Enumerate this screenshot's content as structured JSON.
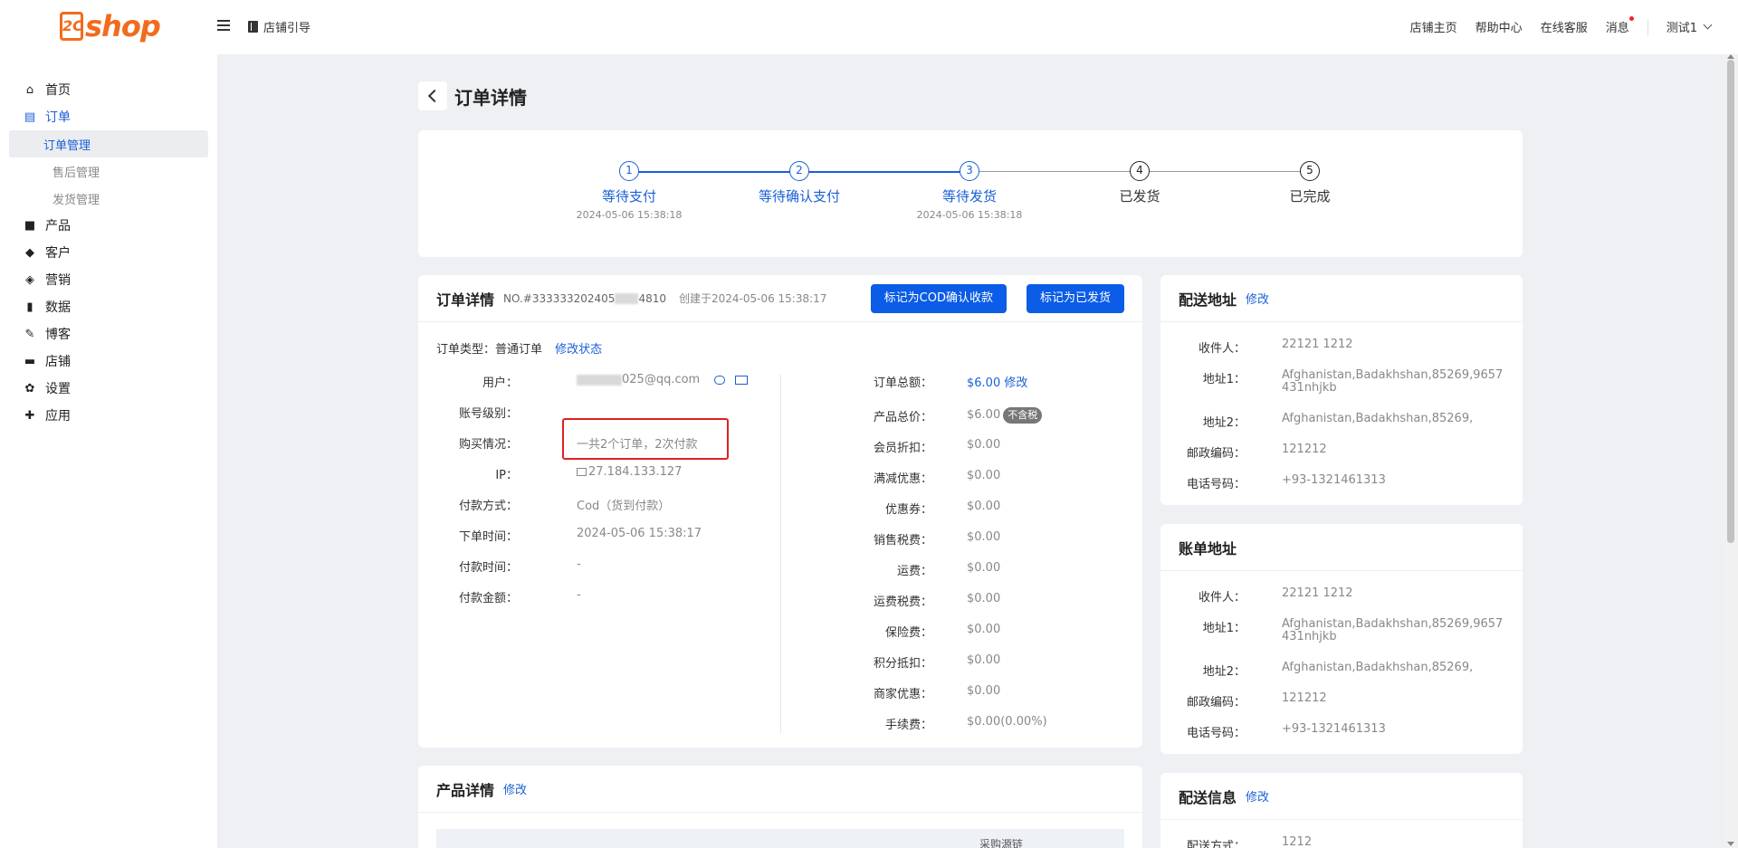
{
  "header": {
    "logo_text": "shop",
    "logo_prefix": "2C",
    "guide_label": "店铺引导",
    "links": [
      "店铺主页",
      "帮助中心",
      "在线客服",
      "消息"
    ],
    "user_name": "测试1"
  },
  "sidebar": {
    "items": [
      {
        "label": "首页",
        "icon": "home-icon"
      },
      {
        "label": "订单",
        "icon": "order-icon"
      },
      {
        "label": "产品",
        "icon": "bag-icon"
      },
      {
        "label": "客户",
        "icon": "diamond-icon"
      },
      {
        "label": "营销",
        "icon": "tag-icon"
      },
      {
        "label": "数据",
        "icon": "bar-chart-icon"
      },
      {
        "label": "博客",
        "icon": "edit-icon"
      },
      {
        "label": "店铺",
        "icon": "store-icon"
      },
      {
        "label": "设置",
        "icon": "gear-icon"
      },
      {
        "label": "应用",
        "icon": "puzzle-icon"
      }
    ],
    "order_sub": [
      "订单管理",
      "售后管理",
      "发货管理"
    ]
  },
  "page": {
    "title": "订单详情"
  },
  "steps": [
    {
      "num": "1",
      "name": "等待支付",
      "time": "2024-05-06 15:38:18",
      "state": "active"
    },
    {
      "num": "2",
      "name": "等待确认支付",
      "time": "",
      "state": "active"
    },
    {
      "num": "3",
      "name": "等待发货",
      "time": "2024-05-06 15:38:18",
      "state": "active"
    },
    {
      "num": "4",
      "name": "已发货",
      "time": "",
      "state": "pending"
    },
    {
      "num": "5",
      "name": "已完成",
      "time": "",
      "state": "pending"
    }
  ],
  "order": {
    "title": "订单详情",
    "number_prefix": "NO.#333333202405",
    "number_suffix": "4810",
    "created": "创建于2024-05-06 15:38:17",
    "btn_cod": "标记为COD确认收款",
    "btn_shipped": "标记为已发货",
    "type_label": "订单类型：普通订单",
    "modify_status": "修改状态",
    "left_labels": [
      "用户：",
      "账号级别：",
      "购买情况：",
      "IP：",
      "付款方式：",
      "下单时间：",
      "付款时间：",
      "付款金额："
    ],
    "user_email_suffix": "025@qq.com",
    "account_level": "",
    "purchase": "一共2个订单，2次付款",
    "ip": "27.184.133.127",
    "pay_method": "Cod（货到付款）",
    "order_time": "2024-05-06 15:38:17",
    "pay_time": "-",
    "pay_amount": "-",
    "right_labels": [
      "订单总额：",
      "产品总价：",
      "会员折扣：",
      "满减优惠：",
      "优惠券：",
      "销售税费：",
      "运费：",
      "运费税费：",
      "保险费：",
      "积分抵扣：",
      "商家优惠：",
      "手续费："
    ],
    "total": "$6.00",
    "total_modify": "修改",
    "product_total": "$6.00",
    "tax_badge": "不含税",
    "right_values": [
      "$0.00",
      "$0.00",
      "$0.00",
      "$0.00",
      "$0.00",
      "$0.00",
      "$0.00",
      "$0.00",
      "$0.00",
      "$0.00(0.00%)"
    ]
  },
  "shipping": {
    "title": "配送地址",
    "modify": "修改",
    "labels": [
      "收件人：",
      "地址1：",
      "地址2：",
      "邮政编码：",
      "电话号码："
    ],
    "values": [
      "22121 1212",
      "Afghanistan,Badakhshan,85269,9657431nhjkb",
      "Afghanistan,Badakhshan,85269,",
      "121212",
      "+93-1321461313"
    ]
  },
  "billing": {
    "title": "账单地址",
    "labels": [
      "收件人：",
      "地址1：",
      "地址2：",
      "邮政编码：",
      "电话号码："
    ],
    "values": [
      "22121 1212",
      "Afghanistan,Badakhshan,85269,9657431nhjkb",
      "Afghanistan,Badakhshan,85269,",
      "121212",
      "+93-1321461313"
    ]
  },
  "product": {
    "title": "产品详情",
    "modify": "修改",
    "col_partial": "采购源链"
  },
  "delivery": {
    "title": "配送信息",
    "modify": "修改",
    "method_label": "配送方式：",
    "method_value": "1212"
  },
  "colors": {
    "accent": "#1a5fd6",
    "button": "#0b5ce6",
    "logo": "#f26b1d",
    "highlight": "#e02020"
  }
}
